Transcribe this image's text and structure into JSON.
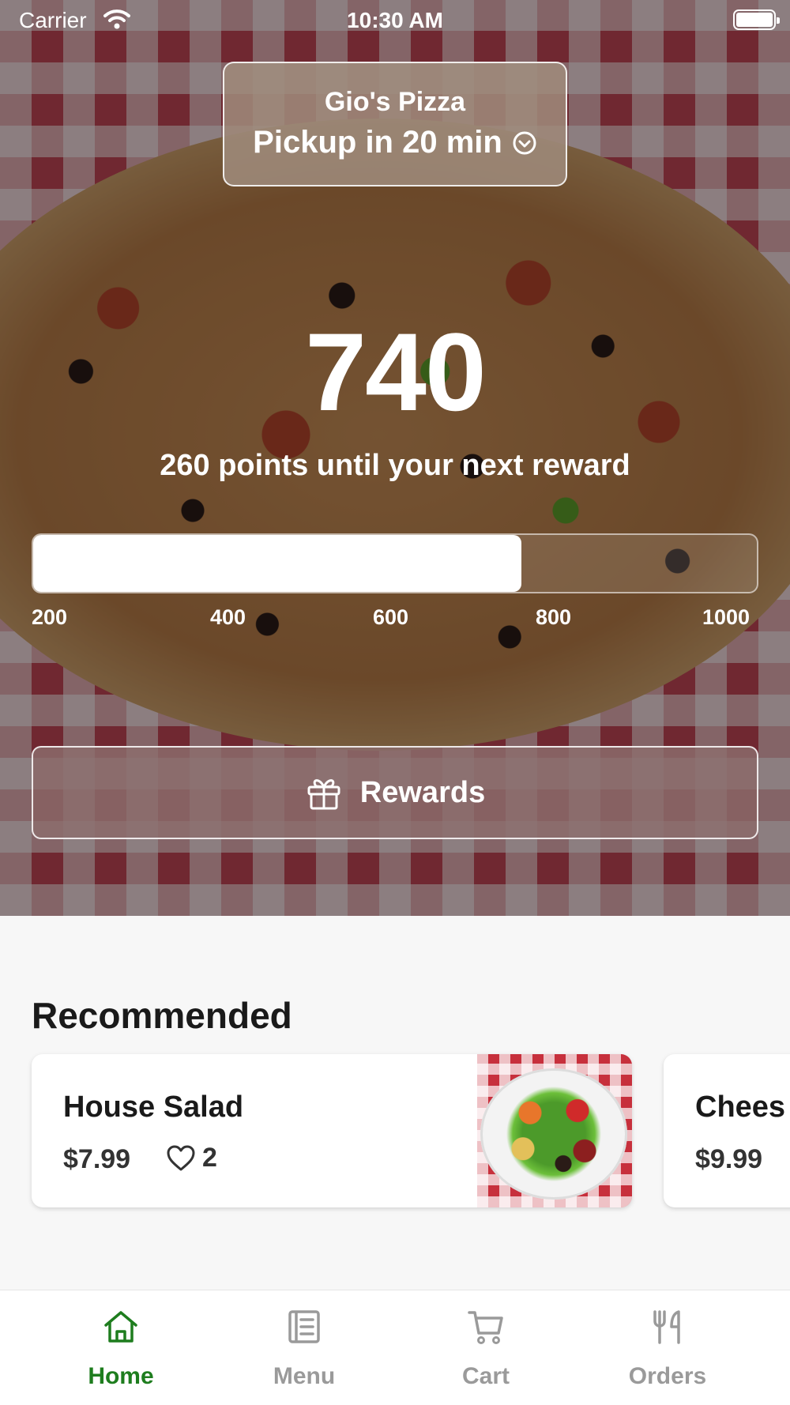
{
  "status_bar": {
    "carrier": "Carrier",
    "time": "10:30 AM"
  },
  "store": {
    "name": "Gio's Pizza",
    "pickup": "Pickup in 20 min"
  },
  "rewards": {
    "points": "740",
    "subtitle": "260 points until your next reward",
    "progress": {
      "value": 740,
      "min": 200,
      "max": 1000
    },
    "ticks": [
      "200",
      "400",
      "600",
      "800",
      "1000"
    ],
    "button_label": "Rewards"
  },
  "recommended": {
    "title": "Recommended",
    "items": [
      {
        "name": "House Salad",
        "price": "$7.99",
        "likes": "2"
      },
      {
        "name": "Chees",
        "price": "$9.99"
      }
    ]
  },
  "tabs": [
    {
      "label": "Home",
      "active": true,
      "icon": "home-icon"
    },
    {
      "label": "Menu",
      "active": false,
      "icon": "menu-icon"
    },
    {
      "label": "Cart",
      "active": false,
      "icon": "cart-icon"
    },
    {
      "label": "Orders",
      "active": false,
      "icon": "orders-icon"
    }
  ],
  "colors": {
    "accent": "#1e7d1e",
    "inactive_tab": "#9a9a9a"
  }
}
